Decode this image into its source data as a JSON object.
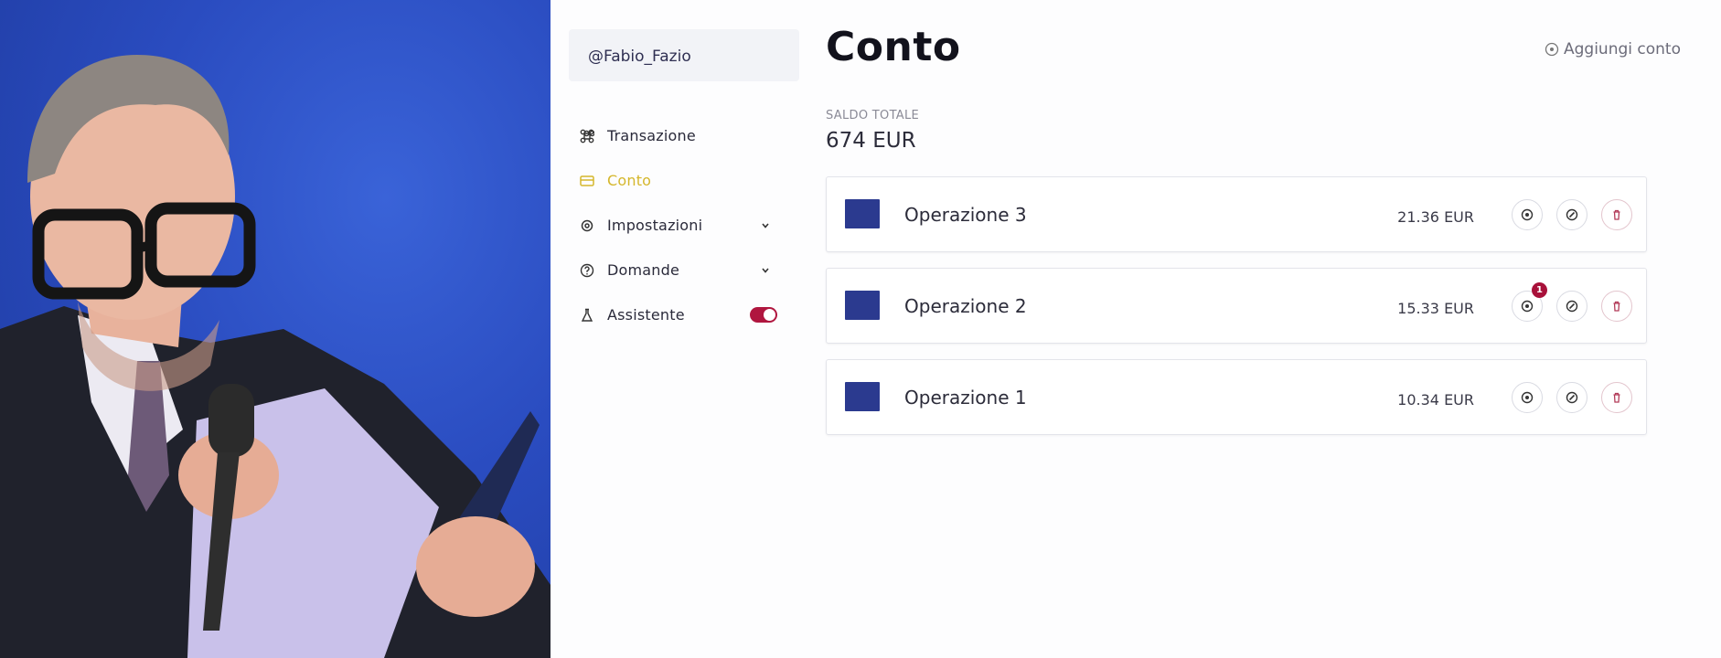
{
  "video": {
    "description_icon": "presenter-video-feed"
  },
  "user": {
    "handle": "@Fabio_Fazio"
  },
  "nav": {
    "items": [
      {
        "label": "Transazione",
        "icon": "command-icon"
      },
      {
        "label": "Conto",
        "icon": "card-icon",
        "active": true
      },
      {
        "label": "Impostazioni",
        "icon": "gear-icon",
        "expandable": true
      },
      {
        "label": "Domande",
        "icon": "help-icon",
        "expandable": true
      },
      {
        "label": "Assistente",
        "icon": "flask-icon",
        "toggle": true,
        "toggle_on": true
      }
    ]
  },
  "page": {
    "title": "Conto",
    "add_account_label": "Aggiungi conto"
  },
  "balance": {
    "label": "SALDO TOTALE",
    "value": "674 EUR"
  },
  "operations": [
    {
      "name": "Operazione 3",
      "amount": "21.36 EUR"
    },
    {
      "name": "Operazione 2",
      "amount": "15.33 EUR",
      "badge": "1"
    },
    {
      "name": "Operazione 1",
      "amount": "10.34 EUR"
    }
  ],
  "colors": {
    "accent_active": "#d5b72c",
    "toggle_on": "#b0163f",
    "badge": "#a8113a",
    "flag": "#2b3a8f"
  }
}
